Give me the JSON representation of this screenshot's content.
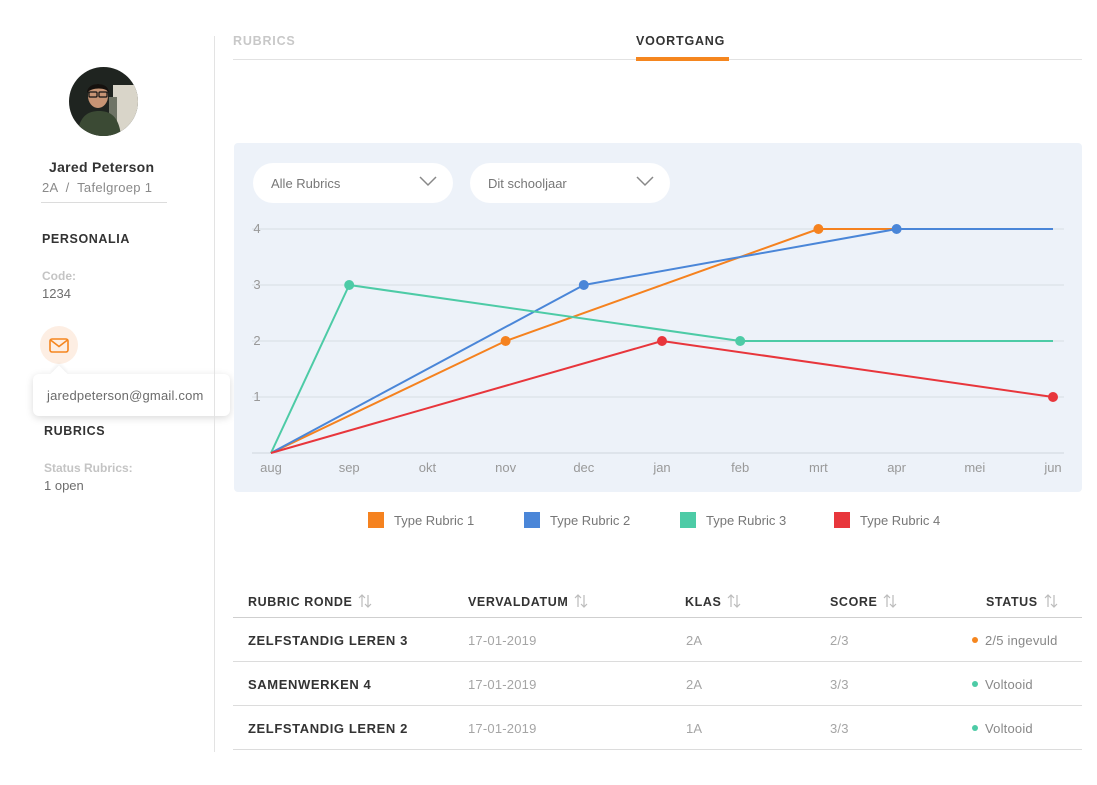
{
  "user": {
    "name": "Jared Peterson",
    "group": "2A  /  Tafelgroep 1",
    "email": "jaredpeterson@gmail.com"
  },
  "sidebar": {
    "personalia_title": "PERSONALIA",
    "code_label": "Code:",
    "code_value": "1234",
    "rubrics_title": "RUBRICS",
    "status_label": "Status Rubrics:",
    "status_value": "1 open"
  },
  "tabs": [
    {
      "label": "RUBRICS",
      "active": false
    },
    {
      "label": "VOORTGANG",
      "active": true
    }
  ],
  "filters": {
    "rubric_select": "Alle Rubrics",
    "period_select": "Dit schooljaar"
  },
  "colors": {
    "accent": "#f5861f",
    "series": [
      "#f5821f",
      "#4a86d8",
      "#4dcba6",
      "#e8363c"
    ]
  },
  "chart_data": {
    "type": "line",
    "x": [
      "aug",
      "sep",
      "okt",
      "nov",
      "dec",
      "jan",
      "feb",
      "mrt",
      "apr",
      "mei",
      "jun"
    ],
    "yticks": [
      1,
      2,
      3,
      4
    ],
    "ylim": [
      0,
      4
    ],
    "grid": true,
    "legend": "bottom",
    "series": [
      {
        "name": "Type Rubric 1",
        "color": "#f5821f",
        "points": [
          {
            "x": "aug",
            "y": 0
          },
          {
            "x": "nov",
            "y": 2
          },
          {
            "x": "mrt",
            "y": 4
          },
          {
            "x": "apr",
            "y": 4
          }
        ],
        "markers": [
          "nov",
          "mrt"
        ]
      },
      {
        "name": "Type Rubric 2",
        "color": "#4a86d8",
        "points": [
          {
            "x": "aug",
            "y": 0
          },
          {
            "x": "dec",
            "y": 3
          },
          {
            "x": "apr",
            "y": 4
          },
          {
            "x": "jun",
            "y": 4
          }
        ],
        "markers": [
          "dec",
          "apr"
        ]
      },
      {
        "name": "Type Rubric 3",
        "color": "#4dcba6",
        "points": [
          {
            "x": "aug",
            "y": 0
          },
          {
            "x": "sep",
            "y": 3
          },
          {
            "x": "feb",
            "y": 2
          },
          {
            "x": "jun",
            "y": 2
          }
        ],
        "markers": [
          "sep",
          "feb"
        ]
      },
      {
        "name": "Type Rubric 4",
        "color": "#e8363c",
        "points": [
          {
            "x": "aug",
            "y": 0
          },
          {
            "x": "jan",
            "y": 2
          },
          {
            "x": "jun",
            "y": 1
          }
        ],
        "markers": [
          "jan",
          "jun"
        ]
      }
    ]
  },
  "table": {
    "headers": [
      "RUBRIC RONDE",
      "VERVALDATUM",
      "KLAS",
      "SCORE",
      "STATUS"
    ],
    "rows": [
      {
        "ronde": "ZELFSTANDIG LEREN 3",
        "vervaldatum": "17-01-2019",
        "klas": "2A",
        "score": "2/3",
        "status": "2/5 ingevuld",
        "status_color": "#f5861f"
      },
      {
        "ronde": "SAMENWERKEN 4",
        "vervaldatum": "17-01-2019",
        "klas": "2A",
        "score": "3/3",
        "status": "Voltooid",
        "status_color": "#4dcba6"
      },
      {
        "ronde": "ZELFSTANDIG LEREN 2",
        "vervaldatum": "17-01-2019",
        "klas": "1A",
        "score": "3/3",
        "status": "Voltooid",
        "status_color": "#4dcba6"
      }
    ]
  }
}
